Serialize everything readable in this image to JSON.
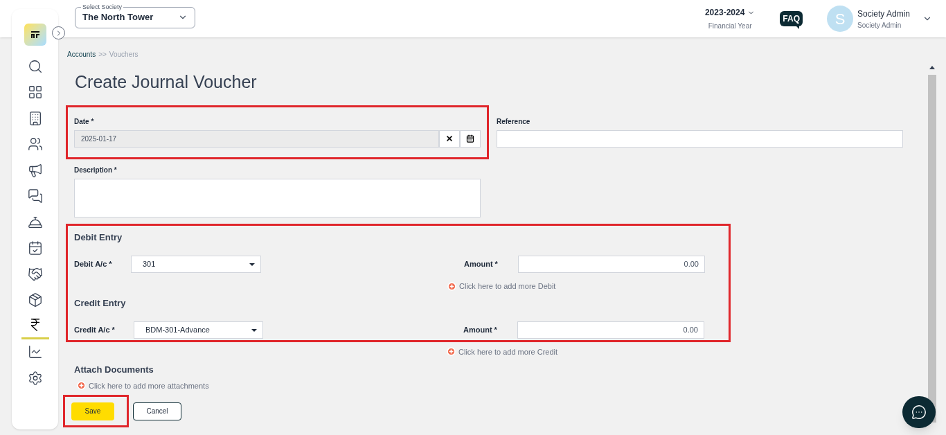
{
  "header": {
    "society_select": {
      "label": "Select Society",
      "value": "The North Tower"
    },
    "financial_year": {
      "value": "2023-2024",
      "label": "Financial Year"
    },
    "faq": "FAQ",
    "user": {
      "initial": "S",
      "name": "Society Admin",
      "role": "Society Admin"
    }
  },
  "sidebar": {
    "items": [
      {
        "selected": false
      },
      {
        "selected": false
      },
      {
        "selected": false
      },
      {
        "selected": false
      },
      {
        "selected": false
      },
      {
        "selected": false
      },
      {
        "selected": false
      },
      {
        "selected": false
      },
      {
        "selected": false
      },
      {
        "selected": false
      },
      {
        "selected": true
      },
      {
        "selected": false
      },
      {
        "selected": false
      }
    ]
  },
  "breadcrumb": {
    "parent": "Accounts",
    "separator": ">>",
    "current": "Vouchers"
  },
  "page_title": "Create Journal Voucher",
  "form": {
    "date": {
      "label": "Date *",
      "value": "2025-01-17"
    },
    "reference": {
      "label": "Reference"
    },
    "description": {
      "label": "Description *"
    },
    "debit": {
      "heading": "Debit Entry",
      "account_label": "Debit A/c *",
      "account": "301",
      "amount_label": "Amount *",
      "amount": "0.00",
      "add_link": "Click here to add more Debit"
    },
    "credit": {
      "heading": "Credit Entry",
      "account_label": "Credit A/c *",
      "account": "BDM-301-Advance",
      "amount_label": "Amount *",
      "amount": "0.00",
      "add_link": "Click here to add more Credit"
    },
    "attachments": {
      "heading": "Attach Documents",
      "add_link": "Click here to add more attachments"
    }
  },
  "buttons": [
    {
      "label": "Save",
      "kind": "primary"
    },
    {
      "label": "Cancel",
      "kind": "secondary"
    }
  ]
}
